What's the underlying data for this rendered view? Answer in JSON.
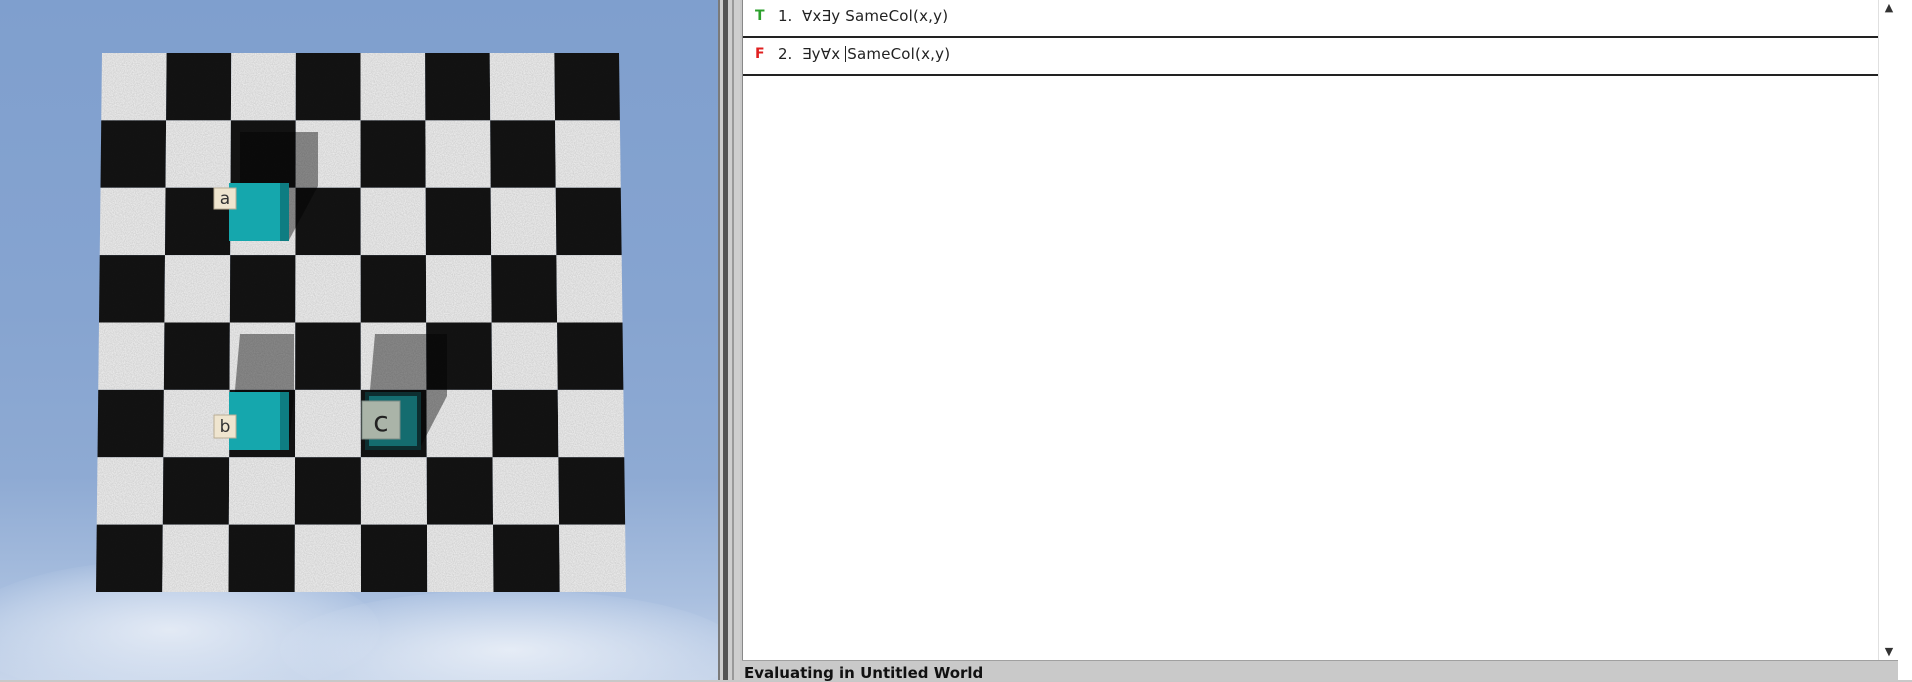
{
  "world": {
    "blocks": [
      {
        "label": "a",
        "color": "#15a7ad"
      },
      {
        "label": "b",
        "color": "#15a7ad"
      },
      {
        "label": "c",
        "color": "#146c6f"
      }
    ]
  },
  "sentences": [
    {
      "value": "T",
      "value_color": "#2ca02c",
      "number": "1.",
      "formula": "∀x∃y SameCol(x,y)"
    },
    {
      "value": "F",
      "value_color": "#e02020",
      "number": "2.",
      "formula_before_caret": "∃y∀x ",
      "formula_after_caret": "SameCol(x,y)"
    }
  ],
  "scrollbar": {
    "up": "▲",
    "down": "▼"
  },
  "status": {
    "text": "Evaluating in Untitled World"
  }
}
